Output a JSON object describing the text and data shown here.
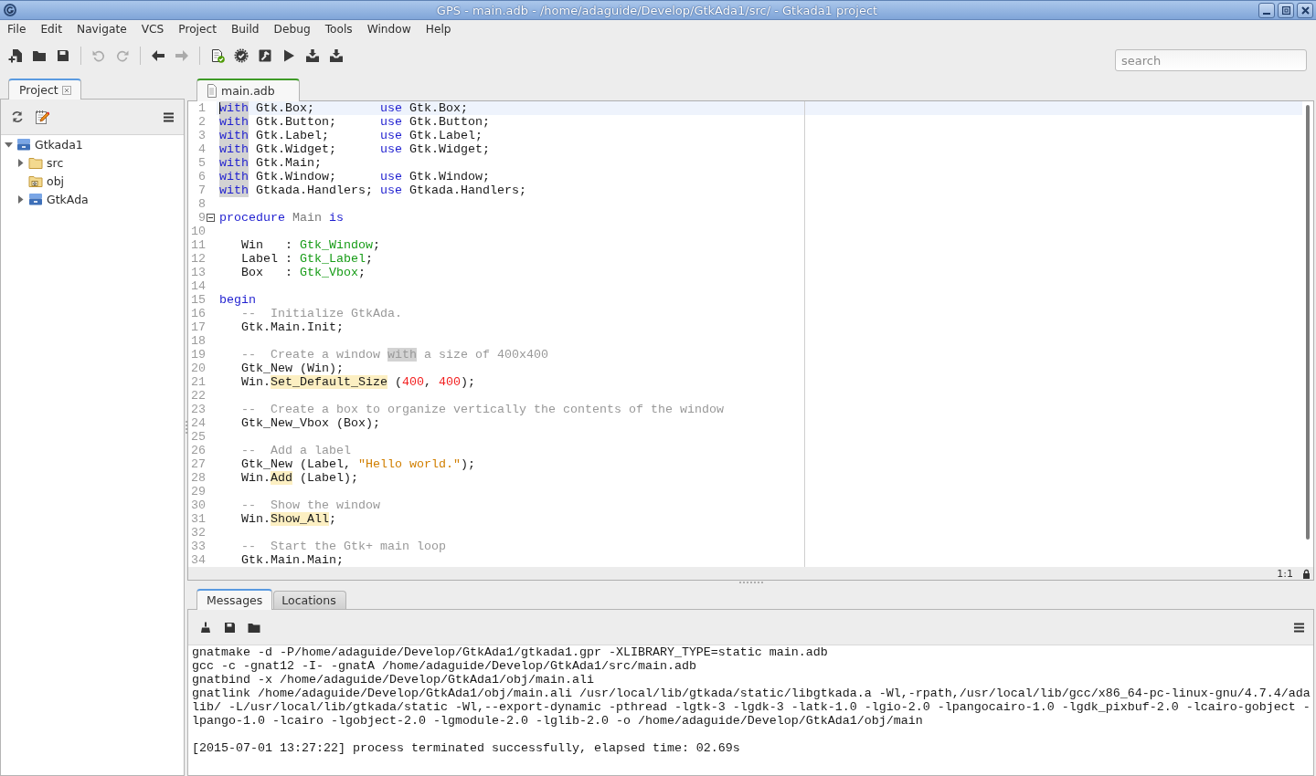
{
  "window": {
    "title": "GPS - main.adb - /home/adaguide/Develop/GtkAda1/src/ - Gtkada1 project"
  },
  "menu": [
    "File",
    "Edit",
    "Navigate",
    "VCS",
    "Project",
    "Build",
    "Debug",
    "Tools",
    "Window",
    "Help"
  ],
  "toolbar": {
    "groups": [
      {
        "buttons": [
          {
            "disabled": false
          },
          {
            "disabled": false
          },
          {
            "disabled": false
          }
        ]
      },
      {
        "buttons": [
          {
            "disabled": true
          },
          {
            "disabled": true
          }
        ]
      },
      {
        "buttons": [
          {
            "disabled": false
          },
          {
            "disabled": true
          }
        ]
      },
      {
        "buttons": [
          {
            "disabled": false
          },
          {
            "disabled": false
          },
          {
            "disabled": false
          },
          {
            "disabled": false
          },
          {
            "disabled": false
          },
          {
            "disabled": false
          }
        ]
      }
    ]
  },
  "search": {
    "placeholder": "search"
  },
  "project_panel": {
    "tabs": [
      {
        "label": "Project",
        "selected": true,
        "focused": false,
        "closable": true
      }
    ],
    "tree": [
      {
        "label": "Gtkada1",
        "kind": "project",
        "expanded": true,
        "children": [
          {
            "label": "src",
            "kind": "folder",
            "expanded": false
          },
          {
            "label": "obj",
            "kind": "object-folder"
          },
          {
            "label": "GtkAda",
            "kind": "project",
            "expanded": false
          }
        ]
      }
    ]
  },
  "editor": {
    "tabs": [
      {
        "label": "main.adb",
        "selected": true,
        "focused": true,
        "closable": false
      }
    ],
    "lines": [
      {
        "number": "1",
        "current": true,
        "tokens": [
          {
            "text": "with",
            "kind": "keyword",
            "occurrence": true,
            "reference": false
          },
          {
            "text": " Gtk.Box;         ",
            "kind": "plain",
            "occurrence": false,
            "reference": false
          },
          {
            "text": "use",
            "kind": "keyword",
            "occurrence": false,
            "reference": false
          },
          {
            "text": " Gtk.Box;",
            "kind": "plain",
            "occurrence": false,
            "reference": false
          }
        ]
      },
      {
        "number": "2",
        "current": false,
        "tokens": [
          {
            "text": "with",
            "kind": "keyword",
            "occurrence": true,
            "reference": false
          },
          {
            "text": " Gtk.Button;      ",
            "kind": "plain",
            "occurrence": false,
            "reference": false
          },
          {
            "text": "use",
            "kind": "keyword",
            "occurrence": false,
            "reference": false
          },
          {
            "text": " Gtk.Button;",
            "kind": "plain",
            "occurrence": false,
            "reference": false
          }
        ]
      },
      {
        "number": "3",
        "current": false,
        "tokens": [
          {
            "text": "with",
            "kind": "keyword",
            "occurrence": true,
            "reference": false
          },
          {
            "text": " Gtk.Label;       ",
            "kind": "plain",
            "occurrence": false,
            "reference": false
          },
          {
            "text": "use",
            "kind": "keyword",
            "occurrence": false,
            "reference": false
          },
          {
            "text": " Gtk.Label;",
            "kind": "plain",
            "occurrence": false,
            "reference": false
          }
        ]
      },
      {
        "number": "4",
        "current": false,
        "tokens": [
          {
            "text": "with",
            "kind": "keyword",
            "occurrence": true,
            "reference": false
          },
          {
            "text": " Gtk.Widget;      ",
            "kind": "plain",
            "occurrence": false,
            "reference": false
          },
          {
            "text": "use",
            "kind": "keyword",
            "occurrence": false,
            "reference": false
          },
          {
            "text": " Gtk.Widget;",
            "kind": "plain",
            "occurrence": false,
            "reference": false
          }
        ]
      },
      {
        "number": "5",
        "current": false,
        "tokens": [
          {
            "text": "with",
            "kind": "keyword",
            "occurrence": true,
            "reference": false
          },
          {
            "text": " Gtk.Main;",
            "kind": "plain",
            "occurrence": false,
            "reference": false
          }
        ]
      },
      {
        "number": "6",
        "current": false,
        "tokens": [
          {
            "text": "with",
            "kind": "keyword",
            "occurrence": true,
            "reference": false
          },
          {
            "text": " Gtk.Window;      ",
            "kind": "plain",
            "occurrence": false,
            "reference": false
          },
          {
            "text": "use",
            "kind": "keyword",
            "occurrence": false,
            "reference": false
          },
          {
            "text": " Gtk.Window;",
            "kind": "plain",
            "occurrence": false,
            "reference": false
          }
        ]
      },
      {
        "number": "7",
        "current": false,
        "tokens": [
          {
            "text": "with",
            "kind": "keyword",
            "occurrence": true,
            "reference": false
          },
          {
            "text": " Gtkada.Handlers; ",
            "kind": "plain",
            "occurrence": false,
            "reference": false
          },
          {
            "text": "use",
            "kind": "keyword",
            "occurrence": false,
            "reference": false
          },
          {
            "text": " Gtkada.Handlers;",
            "kind": "plain",
            "occurrence": false,
            "reference": false
          }
        ]
      },
      {
        "number": "8",
        "current": false
      },
      {
        "number": "9",
        "current": false,
        "expanded": true,
        "tokens": [
          {
            "text": "procedure",
            "kind": "keyword",
            "occurrence": false,
            "reference": false
          },
          {
            "text": " Main ",
            "kind": "name",
            "occurrence": false,
            "reference": false
          },
          {
            "text": "is",
            "kind": "keyword",
            "occurrence": false,
            "reference": false
          }
        ]
      },
      {
        "number": "10",
        "current": false
      },
      {
        "number": "11",
        "current": false,
        "tokens": [
          {
            "text": "   Win   : ",
            "kind": "plain",
            "occurrence": false,
            "reference": false
          },
          {
            "text": "Gtk_Window",
            "kind": "type",
            "occurrence": false,
            "reference": false
          },
          {
            "text": ";",
            "kind": "plain",
            "occurrence": false,
            "reference": false
          }
        ]
      },
      {
        "number": "12",
        "current": false,
        "tokens": [
          {
            "text": "   Label : ",
            "kind": "plain",
            "occurrence": false,
            "reference": false
          },
          {
            "text": "Gtk_Label",
            "kind": "type",
            "occurrence": false,
            "reference": false
          },
          {
            "text": ";",
            "kind": "plain",
            "occurrence": false,
            "reference": false
          }
        ]
      },
      {
        "number": "13",
        "current": false,
        "tokens": [
          {
            "text": "   Box   : ",
            "kind": "plain",
            "occurrence": false,
            "reference": false
          },
          {
            "text": "Gtk_Vbox",
            "kind": "type",
            "occurrence": false,
            "reference": false
          },
          {
            "text": ";",
            "kind": "plain",
            "occurrence": false,
            "reference": false
          }
        ]
      },
      {
        "number": "14",
        "current": false
      },
      {
        "number": "15",
        "current": false,
        "tokens": [
          {
            "text": "begin",
            "kind": "keyword",
            "occurrence": false,
            "reference": false
          }
        ]
      },
      {
        "number": "16",
        "current": false,
        "tokens": [
          {
            "text": "   --  Initialize GtkAda.",
            "kind": "comment",
            "occurrence": false,
            "reference": false
          }
        ]
      },
      {
        "number": "17",
        "current": false,
        "tokens": [
          {
            "text": "   Gtk.Main.Init;",
            "kind": "plain",
            "occurrence": false,
            "reference": false
          }
        ]
      },
      {
        "number": "18",
        "current": false
      },
      {
        "number": "19",
        "current": false,
        "tokens": [
          {
            "text": "   --  Create a window ",
            "kind": "comment",
            "occurrence": false,
            "reference": false
          },
          {
            "text": "with",
            "kind": "comment",
            "occurrence": true,
            "reference": false
          },
          {
            "text": " a size of 400x400",
            "kind": "comment",
            "occurrence": false,
            "reference": false
          }
        ]
      },
      {
        "number": "20",
        "current": false,
        "tokens": [
          {
            "text": "   Gtk_New (Win);",
            "kind": "plain",
            "occurrence": false,
            "reference": false
          }
        ]
      },
      {
        "number": "21",
        "current": false,
        "tokens": [
          {
            "text": "   Win.",
            "kind": "plain",
            "occurrence": false,
            "reference": false
          },
          {
            "text": "Set_Default_Size",
            "kind": "plain",
            "occurrence": false,
            "reference": true
          },
          {
            "text": " (",
            "kind": "plain",
            "occurrence": false,
            "reference": false
          },
          {
            "text": "400",
            "kind": "number",
            "occurrence": false,
            "reference": false
          },
          {
            "text": ", ",
            "kind": "plain",
            "occurrence": false,
            "reference": false
          },
          {
            "text": "400",
            "kind": "number",
            "occurrence": false,
            "reference": false
          },
          {
            "text": ");",
            "kind": "plain",
            "occurrence": false,
            "reference": false
          }
        ]
      },
      {
        "number": "22",
        "current": false
      },
      {
        "number": "23",
        "current": false,
        "tokens": [
          {
            "text": "   --  Create a box to organize vertically the contents of the window",
            "kind": "comment",
            "occurrence": false,
            "reference": false
          }
        ]
      },
      {
        "number": "24",
        "current": false,
        "tokens": [
          {
            "text": "   Gtk_New_Vbox (Box);",
            "kind": "plain",
            "occurrence": false,
            "reference": false
          }
        ]
      },
      {
        "number": "25",
        "current": false
      },
      {
        "number": "26",
        "current": false,
        "tokens": [
          {
            "text": "   --  Add a label",
            "kind": "comment",
            "occurrence": false,
            "reference": false
          }
        ]
      },
      {
        "number": "27",
        "current": false,
        "tokens": [
          {
            "text": "   Gtk_New (Label, ",
            "kind": "plain",
            "occurrence": false,
            "reference": false
          },
          {
            "text": "\"Hello world.\"",
            "kind": "string",
            "occurrence": false,
            "reference": false
          },
          {
            "text": ");",
            "kind": "plain",
            "occurrence": false,
            "reference": false
          }
        ]
      },
      {
        "number": "28",
        "current": false,
        "tokens": [
          {
            "text": "   Win.",
            "kind": "plain",
            "occurrence": false,
            "reference": false
          },
          {
            "text": "Add",
            "kind": "plain",
            "occurrence": false,
            "reference": true
          },
          {
            "text": " (Label);",
            "kind": "plain",
            "occurrence": false,
            "reference": false
          }
        ]
      },
      {
        "number": "29",
        "current": false
      },
      {
        "number": "30",
        "current": false,
        "tokens": [
          {
            "text": "   --  Show the window",
            "kind": "comment",
            "occurrence": false,
            "reference": false
          }
        ]
      },
      {
        "number": "31",
        "current": false,
        "tokens": [
          {
            "text": "   Win.",
            "kind": "plain",
            "occurrence": false,
            "reference": false
          },
          {
            "text": "Show_All",
            "kind": "plain",
            "occurrence": false,
            "reference": true
          },
          {
            "text": ";",
            "kind": "plain",
            "occurrence": false,
            "reference": false
          }
        ]
      },
      {
        "number": "32",
        "current": false
      },
      {
        "number": "33",
        "current": false,
        "tokens": [
          {
            "text": "   --  Start the Gtk+ main loop",
            "kind": "comment",
            "occurrence": false,
            "reference": false
          }
        ]
      },
      {
        "number": "34",
        "current": false,
        "tokens": [
          {
            "text": "   Gtk.Main.Main;",
            "kind": "plain",
            "occurrence": false,
            "reference": false
          }
        ]
      }
    ],
    "cursor_position": "1:1"
  },
  "messages_panel": {
    "tabs": [
      {
        "label": "Messages",
        "selected": true,
        "focused": false,
        "closable": false
      },
      {
        "label": "Locations",
        "selected": false,
        "focused": false,
        "closable": false
      }
    ],
    "lines": [
      {
        "text": "gnatmake -d -P/home/adaguide/Develop/GtkAda1/gtkada1.gpr -XLIBRARY_TYPE=static main.adb",
        "kind": "command"
      },
      {
        "text": "gcc -c -gnat12 -I- -gnatA /home/adaguide/Develop/GtkAda1/src/main.adb",
        "kind": "command"
      },
      {
        "text": "gnatbind -x /home/adaguide/Develop/GtkAda1/obj/main.ali",
        "kind": "command"
      },
      {
        "text": "gnatlink /home/adaguide/Develop/GtkAda1/obj/main.ali /usr/local/lib/gtkada/static/libgtkada.a -Wl,-rpath,/usr/local/lib/gcc/x86_64-pc-linux-gnu/4.7.4/adalib/ -L/usr/local/lib/gtkada/static -Wl,--export-dynamic -pthread -lgtk-3 -lgdk-3 -latk-1.0 -lgio-2.0 -lpangocairo-1.0 -lgdk_pixbuf-2.0 -lcairo-gobject -lpango-1.0 -lcairo -lgobject-2.0 -lgmodule-2.0 -lglib-2.0 -o /home/adaguide/Develop/GtkAda1/obj/main",
        "kind": "command"
      },
      {
        "text": "[2015-07-01 13:27:22] process terminated successfully, elapsed time: 02.69s",
        "kind": "result"
      }
    ]
  }
}
